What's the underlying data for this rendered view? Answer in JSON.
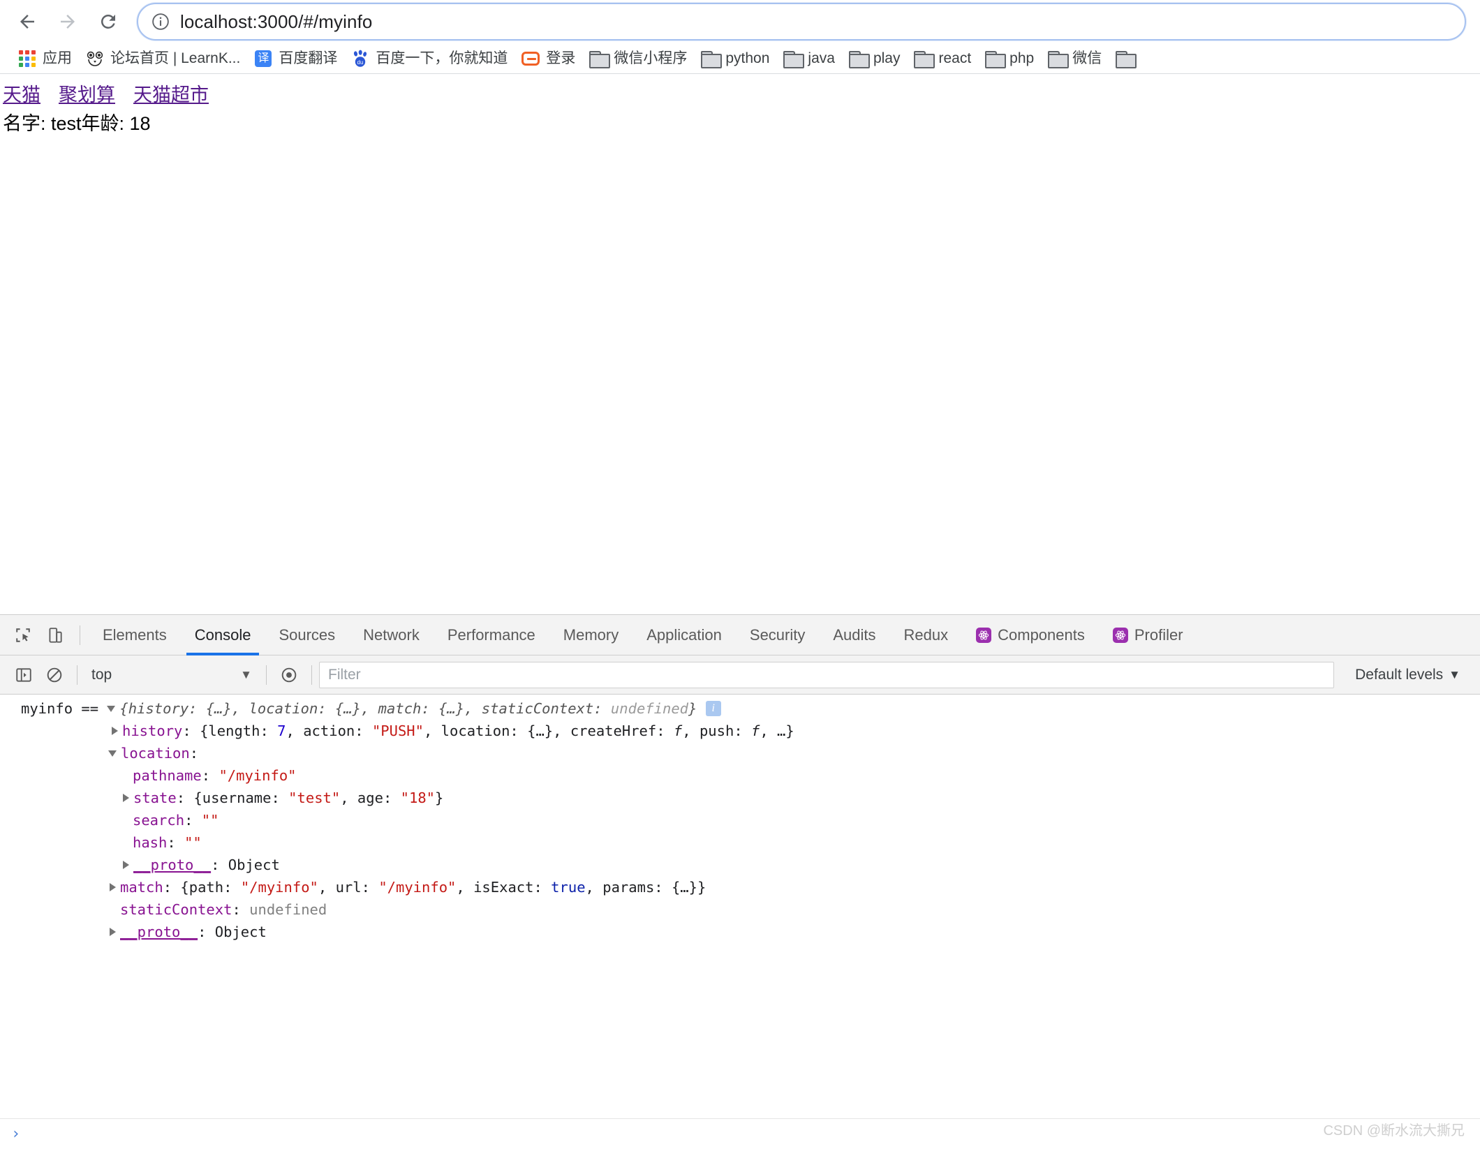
{
  "browser": {
    "nav": {
      "back_label": "Back",
      "forward_label": "Forward",
      "reload_label": "Reload"
    },
    "omnibox": {
      "url": "localhost:3000/#/myinfo",
      "site_info_icon": "info-circle-icon"
    },
    "bookmarks": [
      {
        "label": "应用",
        "icon": "apps-grid-icon"
      },
      {
        "label": "论坛首页 | LearnK...",
        "icon": "learnku-dog-icon"
      },
      {
        "label": "百度翻译",
        "icon": "baidu-translate-icon"
      },
      {
        "label": "百度一下，你就知道",
        "icon": "baidu-paw-icon"
      },
      {
        "label": "登录",
        "icon": "login-icon"
      },
      {
        "label": "微信小程序",
        "icon": "folder-icon"
      },
      {
        "label": "python",
        "icon": "folder-icon"
      },
      {
        "label": "java",
        "icon": "folder-icon"
      },
      {
        "label": "play",
        "icon": "folder-icon"
      },
      {
        "label": "react",
        "icon": "folder-icon"
      },
      {
        "label": "php",
        "icon": "folder-icon"
      },
      {
        "label": "微信",
        "icon": "folder-icon"
      },
      {
        "label": "",
        "icon": "folder-icon"
      }
    ]
  },
  "page": {
    "links": [
      {
        "label": "天猫"
      },
      {
        "label": "聚划算"
      },
      {
        "label": "天猫超市"
      }
    ],
    "info_text": "名字: test年龄: 18",
    "link_color": "#551a8b"
  },
  "devtools": {
    "tabs": [
      {
        "label": "Elements",
        "active": false,
        "icon": null
      },
      {
        "label": "Console",
        "active": true,
        "icon": null
      },
      {
        "label": "Sources",
        "active": false,
        "icon": null
      },
      {
        "label": "Network",
        "active": false,
        "icon": null
      },
      {
        "label": "Performance",
        "active": false,
        "icon": null
      },
      {
        "label": "Memory",
        "active": false,
        "icon": null
      },
      {
        "label": "Application",
        "active": false,
        "icon": null
      },
      {
        "label": "Security",
        "active": false,
        "icon": null
      },
      {
        "label": "Audits",
        "active": false,
        "icon": null
      },
      {
        "label": "Redux",
        "active": false,
        "icon": null
      },
      {
        "label": "Components",
        "active": false,
        "icon": "react-icon"
      },
      {
        "label": "Profiler",
        "active": false,
        "icon": "react-icon"
      }
    ],
    "toolbar": {
      "inspect_icon": "inspect-cursor-icon",
      "device_toolbar_icon": "device-toolbar-icon"
    },
    "filterbar": {
      "sidebar_toggle_icon": "console-sidebar-icon",
      "clear_icon": "clear-console-icon",
      "context": "top",
      "context_caret": "▼",
      "eye_icon": "live-expression-eye-icon",
      "filter_placeholder": "Filter",
      "filter_value": "",
      "levels_label": "Default levels",
      "levels_caret": "▼"
    },
    "console": {
      "prompt_caret": "›",
      "lines": [
        {
          "id": "l0",
          "indent": 30,
          "segments": [
            {
              "t": "myinfo == ",
              "c": "plain"
            },
            {
              "t": "tri-down",
              "c": "icon"
            },
            {
              "t": "{history: {…}, location: {…}, match: {…}, staticContext: ",
              "c": "ital"
            },
            {
              "t": "undefined",
              "c": "ital-undef"
            },
            {
              "t": "}",
              "c": "ital"
            },
            {
              "t": " ",
              "c": "plain"
            },
            {
              "t": "info-badge",
              "c": "icon"
            }
          ]
        },
        {
          "id": "l1",
          "indent": 160,
          "segments": [
            {
              "t": "tri-right",
              "c": "icon"
            },
            {
              "t": "history",
              "c": "prop"
            },
            {
              "t": ": {length: ",
              "c": "plain"
            },
            {
              "t": "7",
              "c": "num"
            },
            {
              "t": ", action: ",
              "c": "plain"
            },
            {
              "t": "\"PUSH\"",
              "c": "str"
            },
            {
              "t": ", location: {…}, createHref: ",
              "c": "plain"
            },
            {
              "t": "f",
              "c": "fn"
            },
            {
              "t": ", push: ",
              "c": "plain"
            },
            {
              "t": "f",
              "c": "fn"
            },
            {
              "t": ", …}",
              "c": "plain"
            }
          ]
        },
        {
          "id": "l2",
          "indent": 155,
          "segments": [
            {
              "t": "tri-down",
              "c": "icon"
            },
            {
              "t": "location",
              "c": "prop"
            },
            {
              "t": ":",
              "c": "plain"
            }
          ]
        },
        {
          "id": "l3",
          "indent": 190,
          "segments": [
            {
              "t": "pathname",
              "c": "prop"
            },
            {
              "t": ": ",
              "c": "plain"
            },
            {
              "t": "\"/myinfo\"",
              "c": "str"
            }
          ]
        },
        {
          "id": "l4",
          "indent": 176,
          "segments": [
            {
              "t": "tri-right",
              "c": "icon"
            },
            {
              "t": "state",
              "c": "prop"
            },
            {
              "t": ": {username: ",
              "c": "plain"
            },
            {
              "t": "\"test\"",
              "c": "str"
            },
            {
              "t": ", age: ",
              "c": "plain"
            },
            {
              "t": "\"18\"",
              "c": "str"
            },
            {
              "t": "}",
              "c": "plain"
            }
          ]
        },
        {
          "id": "l5",
          "indent": 190,
          "segments": [
            {
              "t": "search",
              "c": "prop"
            },
            {
              "t": ": ",
              "c": "plain"
            },
            {
              "t": "\"\"",
              "c": "str"
            }
          ]
        },
        {
          "id": "l6",
          "indent": 190,
          "segments": [
            {
              "t": "hash",
              "c": "prop"
            },
            {
              "t": ": ",
              "c": "plain"
            },
            {
              "t": "\"\"",
              "c": "str"
            }
          ]
        },
        {
          "id": "l7",
          "indent": 176,
          "segments": [
            {
              "t": "tri-right",
              "c": "icon"
            },
            {
              "t": "__proto__",
              "c": "proto"
            },
            {
              "t": ": Object",
              "c": "plain"
            }
          ]
        },
        {
          "id": "l8",
          "indent": 157,
          "segments": [
            {
              "t": "tri-right",
              "c": "icon"
            },
            {
              "t": "match",
              "c": "prop"
            },
            {
              "t": ": {path: ",
              "c": "plain"
            },
            {
              "t": "\"/myinfo\"",
              "c": "str"
            },
            {
              "t": ", url: ",
              "c": "plain"
            },
            {
              "t": "\"/myinfo\"",
              "c": "str"
            },
            {
              "t": ", isExact: ",
              "c": "plain"
            },
            {
              "t": "true",
              "c": "bool"
            },
            {
              "t": ", params: {…}}",
              "c": "plain"
            }
          ]
        },
        {
          "id": "l9",
          "indent": 172,
          "segments": [
            {
              "t": "staticContext",
              "c": "prop"
            },
            {
              "t": ": ",
              "c": "plain"
            },
            {
              "t": "undefined",
              "c": "undef"
            }
          ]
        },
        {
          "id": "l10",
          "indent": 157,
          "segments": [
            {
              "t": "tri-right",
              "c": "icon"
            },
            {
              "t": "__proto__",
              "c": "proto"
            },
            {
              "t": ": Object",
              "c": "plain"
            }
          ]
        }
      ]
    }
  },
  "watermark": "CSDN @断水流大撕兄"
}
